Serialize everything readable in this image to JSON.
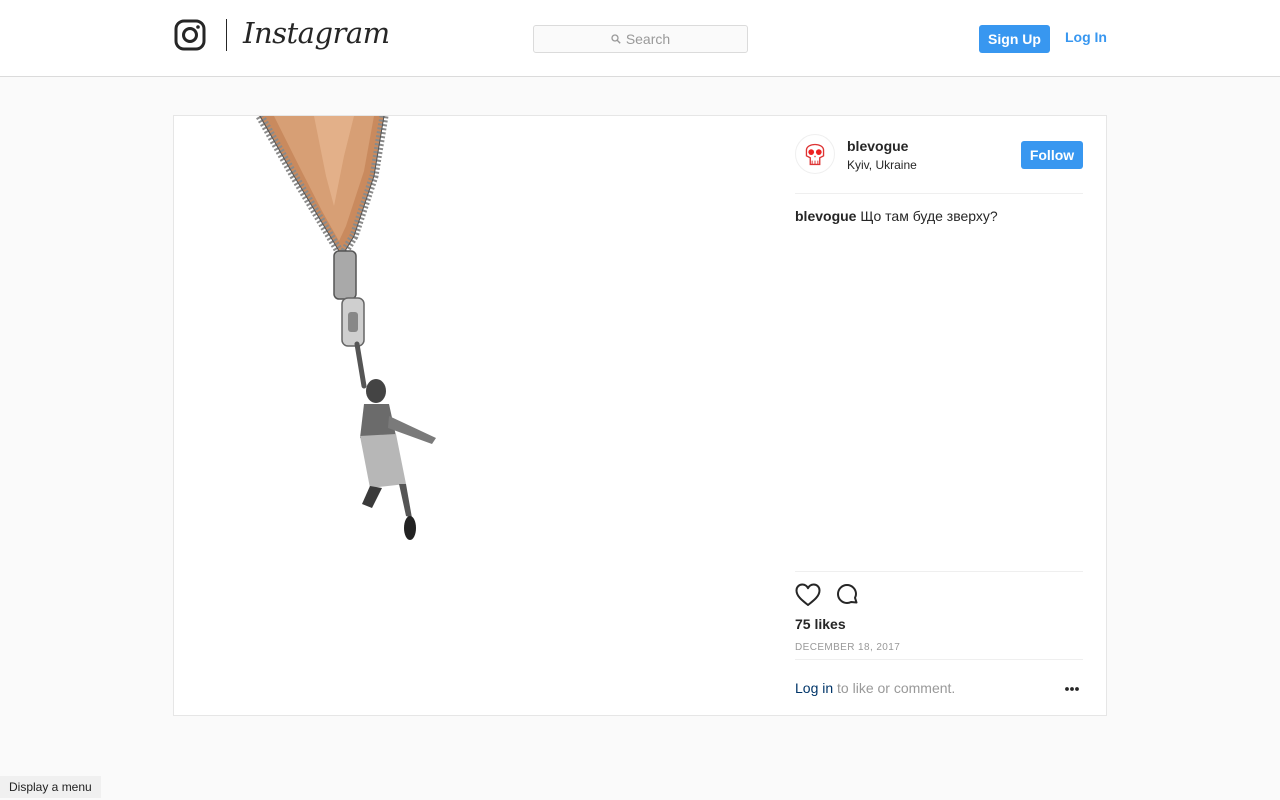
{
  "header": {
    "brand": "Instagram",
    "search_placeholder": "Search",
    "signup_label": "Sign Up",
    "login_label": "Log In",
    "accent_color": "#3897f0"
  },
  "post": {
    "username": "blevogue",
    "location": "Kyiv, Ukraine",
    "follow_label": "Follow",
    "caption_user": "blevogue",
    "caption_text": "Що там буде зверху?",
    "likes_count": "75",
    "likes_label": "likes",
    "date": "DECEMBER 18, 2017",
    "login_link": "Log in",
    "login_suffix": "to like or comment.",
    "image": "zipper-pull-with-child-photo"
  },
  "icons": {
    "brand": "instagram-camera-icon",
    "search": "search-icon",
    "like": "heart-icon",
    "comment": "comment-bubble-icon",
    "more": "more-options-icon",
    "avatar": "skull-avatar"
  },
  "tooltip": "Display a menu"
}
